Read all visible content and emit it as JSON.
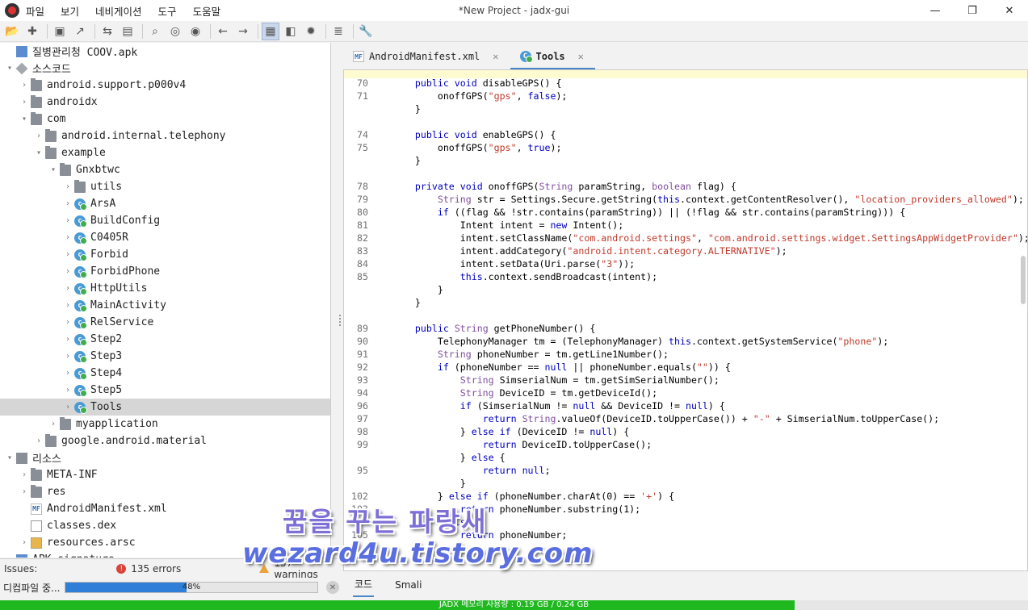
{
  "window": {
    "title": "*New Project - jadx-gui",
    "menu": [
      "파일",
      "보기",
      "네비게이션",
      "도구",
      "도움말"
    ],
    "controls": [
      "—",
      "❐",
      "✕"
    ]
  },
  "toolbar": {
    "icons": [
      "open-folder-icon",
      "add-file-icon",
      "save-icon",
      "export-icon",
      "sync-icon",
      "flatten-icon",
      "search-icon",
      "find-usage-icon",
      "find-class-icon",
      "back-icon",
      "forward-icon",
      "deobfuscation-icon",
      "quark-icon",
      "debug-icon",
      "log-icon",
      "preferences-icon"
    ]
  },
  "tree": {
    "rows": [
      {
        "label": "질병관리청 COOV.apk",
        "indent": 0,
        "arrow": "",
        "icon": "apk"
      },
      {
        "label": "소스코드",
        "indent": 0,
        "arrow": "▾",
        "icon": "pkg"
      },
      {
        "label": "android.support.p000v4",
        "indent": 1,
        "arrow": "›",
        "icon": "folder"
      },
      {
        "label": "androidx",
        "indent": 1,
        "arrow": "›",
        "icon": "folder"
      },
      {
        "label": "com",
        "indent": 1,
        "arrow": "▾",
        "icon": "folder"
      },
      {
        "label": "android.internal.telephony",
        "indent": 2,
        "arrow": "›",
        "icon": "folder"
      },
      {
        "label": "example",
        "indent": 2,
        "arrow": "▾",
        "icon": "folder"
      },
      {
        "label": "Gnxbtwc",
        "indent": 3,
        "arrow": "▾",
        "icon": "folder"
      },
      {
        "label": "utils",
        "indent": 4,
        "arrow": "›",
        "icon": "folder"
      },
      {
        "label": "ArsA",
        "indent": 4,
        "arrow": "›",
        "icon": "cls"
      },
      {
        "label": "BuildConfig",
        "indent": 4,
        "arrow": "›",
        "icon": "cls"
      },
      {
        "label": "C0405R",
        "indent": 4,
        "arrow": "›",
        "icon": "cls"
      },
      {
        "label": "Forbid",
        "indent": 4,
        "arrow": "›",
        "icon": "cls"
      },
      {
        "label": "ForbidPhone",
        "indent": 4,
        "arrow": "›",
        "icon": "cls"
      },
      {
        "label": "HttpUtils",
        "indent": 4,
        "arrow": "›",
        "icon": "cls"
      },
      {
        "label": "MainActivity",
        "indent": 4,
        "arrow": "›",
        "icon": "cls"
      },
      {
        "label": "RelService",
        "indent": 4,
        "arrow": "›",
        "icon": "cls"
      },
      {
        "label": "Step2",
        "indent": 4,
        "arrow": "›",
        "icon": "cls"
      },
      {
        "label": "Step3",
        "indent": 4,
        "arrow": "›",
        "icon": "cls"
      },
      {
        "label": "Step4",
        "indent": 4,
        "arrow": "›",
        "icon": "cls"
      },
      {
        "label": "Step5",
        "indent": 4,
        "arrow": "›",
        "icon": "cls"
      },
      {
        "label": "Tools",
        "indent": 4,
        "arrow": "›",
        "icon": "cls",
        "selected": true
      },
      {
        "label": "myapplication",
        "indent": 3,
        "arrow": "›",
        "icon": "folder"
      },
      {
        "label": "google.android.material",
        "indent": 2,
        "arrow": "›",
        "icon": "folder"
      },
      {
        "label": "리소스",
        "indent": 0,
        "arrow": "▾",
        "icon": "res"
      },
      {
        "label": "META-INF",
        "indent": 1,
        "arrow": "›",
        "icon": "folder"
      },
      {
        "label": "res",
        "indent": 1,
        "arrow": "›",
        "icon": "folder"
      },
      {
        "label": "AndroidManifest.xml",
        "indent": 1,
        "arrow": "",
        "icon": "mf"
      },
      {
        "label": "classes.dex",
        "indent": 1,
        "arrow": "",
        "icon": "dex"
      },
      {
        "label": "resources.arsc",
        "indent": 1,
        "arrow": "›",
        "icon": "arsc"
      },
      {
        "label": "APK signature",
        "indent": 0,
        "arrow": "",
        "icon": "apk"
      }
    ]
  },
  "issues": {
    "label": "Issues:",
    "errors": "135 errors",
    "warnings": "157 warnings"
  },
  "progress": {
    "label": "디컴파일 중...",
    "percent_text": "48%",
    "value": 0.48
  },
  "tabs": [
    {
      "label": "AndroidManifest.xml",
      "icon": "MF",
      "active": false
    },
    {
      "label": "Tools",
      "icon": "C",
      "active": true
    }
  ],
  "close_symbol": "✕",
  "code": [
    {
      "ln": "70",
      "t": "    <k>public</k> <k>void</k> disableGPS() {"
    },
    {
      "ln": "71",
      "t": "        onoffGPS(<s>\"gps\"</s>, <k>false</k>);"
    },
    {
      "ln": "",
      "t": "    }"
    },
    {
      "ln": "",
      "t": ""
    },
    {
      "ln": "74",
      "t": "    <k>public</k> <k>void</k> enableGPS() {"
    },
    {
      "ln": "75",
      "t": "        onoffGPS(<s>\"gps\"</s>, <k>true</k>);"
    },
    {
      "ln": "",
      "t": "    }"
    },
    {
      "ln": "",
      "t": ""
    },
    {
      "ln": "78",
      "t": "    <k>private</k> <k>void</k> onoffGPS(<y>String</y> paramString, <y>boolean</y> flag) {"
    },
    {
      "ln": "79",
      "t": "        <y>String</y> str = Settings.Secure.getString(<k>this</k>.context.getContentResolver(), <s>\"location_providers_allowed\"</s>);"
    },
    {
      "ln": "80",
      "t": "        <k>if</k> ((flag && !str.contains(paramString)) || (!flag && str.contains(paramString))) {"
    },
    {
      "ln": "81",
      "t": "            Intent intent = <k>new</k> Intent();"
    },
    {
      "ln": "82",
      "t": "            intent.setClassName(<s>\"com.android.settings\"</s>, <s>\"com.android.settings.widget.SettingsAppWidgetProvider\"</s>);"
    },
    {
      "ln": "83",
      "t": "            intent.addCategory(<s>\"android.intent.category.ALTERNATIVE\"</s>);"
    },
    {
      "ln": "84",
      "t": "            intent.setData(Uri.parse(<s>\"3\"</s>));"
    },
    {
      "ln": "85",
      "t": "            <k>this</k>.context.sendBroadcast(intent);"
    },
    {
      "ln": "",
      "t": "        }"
    },
    {
      "ln": "",
      "t": "    }"
    },
    {
      "ln": "",
      "t": ""
    },
    {
      "ln": "89",
      "t": "    <k>public</k> <y>String</y> getPhoneNumber() {"
    },
    {
      "ln": "90",
      "t": "        TelephonyManager tm = (TelephonyManager) <k>this</k>.context.getSystemService(<s>\"phone\"</s>);"
    },
    {
      "ln": "91",
      "t": "        <y>String</y> phoneNumber = tm.getLine1Number();"
    },
    {
      "ln": "92",
      "t": "        <k>if</k> (phoneNumber == <k>null</k> || phoneNumber.equals(<s>\"\"</s>)) {"
    },
    {
      "ln": "93",
      "t": "            <y>String</y> SimserialNum = tm.getSimSerialNumber();"
    },
    {
      "ln": "94",
      "t": "            <y>String</y> DeviceID = tm.getDeviceId();"
    },
    {
      "ln": "96",
      "t": "            <k>if</k> (SimserialNum != <k>null</k> && DeviceID != <k>null</k>) {"
    },
    {
      "ln": "97",
      "t": "                <k>return</k> <y>String</y>.valueOf(DeviceID.toUpperCase()) + <s>\"-\"</s> + SimserialNum.toUpperCase();"
    },
    {
      "ln": "98",
      "t": "            } <k>else</k> <k>if</k> (DeviceID != <k>null</k>) {"
    },
    {
      "ln": "99",
      "t": "                <k>return</k> DeviceID.toUpperCase();"
    },
    {
      "ln": "",
      "t": "            } <k>else</k> {"
    },
    {
      "ln": "95",
      "t": "                <k>return</k> <k>null</k>;"
    },
    {
      "ln": "",
      "t": "            }"
    },
    {
      "ln": "102",
      "t": "        } <k>else</k> <k>if</k> (phoneNumber.charAt(0) == <s>'+'</s>) {"
    },
    {
      "ln": "103",
      "t": "            <k>return</k> phoneNumber.substring(1);"
    },
    {
      "ln": "",
      "t": "        } <k>else</k> {"
    },
    {
      "ln": "105",
      "t": "            <k>return</k> phoneNumber;"
    }
  ],
  "bottom_tabs": [
    "코드",
    "Smali"
  ],
  "memory": {
    "text": "JADX 메모리 사용량 : 0.19 GB / 0.24 GB",
    "value": 0.773
  },
  "watermark": {
    "line1": "꿈을 꾸는 파랑새",
    "line2": "wezard4u.tistory.com"
  },
  "colors": {
    "keyword": "#0000c0",
    "type": "#7f4f9e",
    "string": "#c0392b",
    "selection": "#d6d6d6",
    "progress": "#2f7ed8",
    "memory": "#1fb81f"
  }
}
